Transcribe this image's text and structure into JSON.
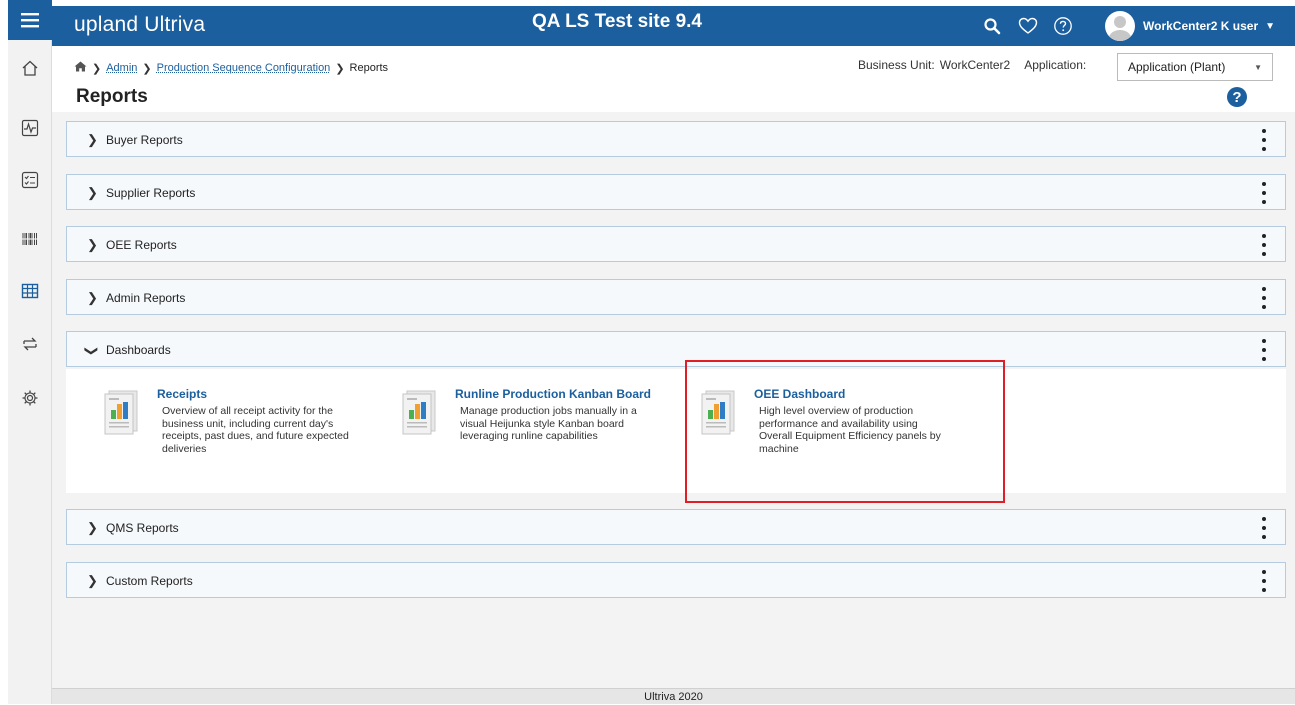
{
  "header": {
    "brand": "upland Ultriva",
    "site_title": "QA LS Test site 9.4",
    "user_name": "WorkCenter2 K user"
  },
  "sidebar": {
    "items": [
      {
        "icon": "home-icon"
      },
      {
        "icon": "activity-monitor-icon"
      },
      {
        "icon": "checklist-icon"
      },
      {
        "icon": "barcode-icon"
      },
      {
        "icon": "reports-grid-icon"
      },
      {
        "icon": "exchange-arrows-icon"
      },
      {
        "icon": "settings-gear-icon"
      }
    ]
  },
  "breadcrumb": {
    "items": [
      "Admin",
      "Production Sequence Configuration"
    ],
    "current": "Reports"
  },
  "page_title": "Reports",
  "business_unit": {
    "label": "Business Unit:",
    "value": "WorkCenter2"
  },
  "application": {
    "label": "Application:",
    "selected": "Application (Plant)"
  },
  "sections": [
    {
      "title": "Buyer Reports",
      "expanded": false
    },
    {
      "title": "Supplier Reports",
      "expanded": false
    },
    {
      "title": "OEE Reports",
      "expanded": false
    },
    {
      "title": "Admin Reports",
      "expanded": false
    },
    {
      "title": "Dashboards",
      "expanded": true
    },
    {
      "title": "QMS Reports",
      "expanded": false
    },
    {
      "title": "Custom Reports",
      "expanded": false
    }
  ],
  "dashboards": [
    {
      "title": "Receipts",
      "lines": [
        "Overview of all receipt activity for the",
        "business unit, including current day's",
        "receipts, past dues, and future expected",
        "deliveries"
      ]
    },
    {
      "title": "Runline Production Kanban Board",
      "lines": [
        "Manage production jobs manually in a",
        "visual Heijunka style Kanban board",
        "leveraging runline capabilities"
      ]
    },
    {
      "title": "OEE Dashboard",
      "lines": [
        "High level overview of production",
        "performance and availability using",
        "Overall Equipment Efficiency panels by",
        "machine"
      ]
    }
  ],
  "footer": "Ultriva 2020",
  "colors": {
    "brand_blue": "#1b5f9e",
    "highlight_red": "#e01e26"
  }
}
